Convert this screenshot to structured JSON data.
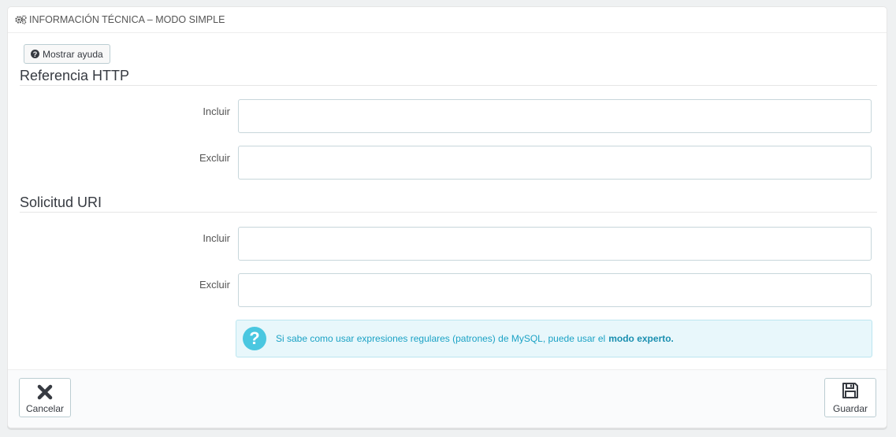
{
  "panel": {
    "title": "INFORMACIÓN TÉCNICA – MODO SIMPLE",
    "title_icon": "cogs-icon"
  },
  "help_button": {
    "label": "Mostrar ayuda",
    "icon": "question-circle-icon"
  },
  "sections": [
    {
      "title": "Referencia HTTP",
      "fields": [
        {
          "label": "Incluir",
          "value": ""
        },
        {
          "label": "Excluir",
          "value": ""
        }
      ]
    },
    {
      "title": "Solicitud URI",
      "fields": [
        {
          "label": "Incluir",
          "value": ""
        },
        {
          "label": "Excluir",
          "value": ""
        }
      ]
    }
  ],
  "info_alert": {
    "text": "Si sabe como usar expresiones regulares (patrones) de MySQL, puede usar el",
    "link_text": "modo experto.",
    "icon": "question-icon"
  },
  "footer": {
    "cancel_label": "Cancelar",
    "cancel_icon": "close-icon",
    "save_label": "Guardar",
    "save_icon": "save-icon"
  },
  "colors": {
    "accent": "#25b9d7",
    "info_bg": "#e8f7fb",
    "info_text": "#1ba2c5"
  }
}
